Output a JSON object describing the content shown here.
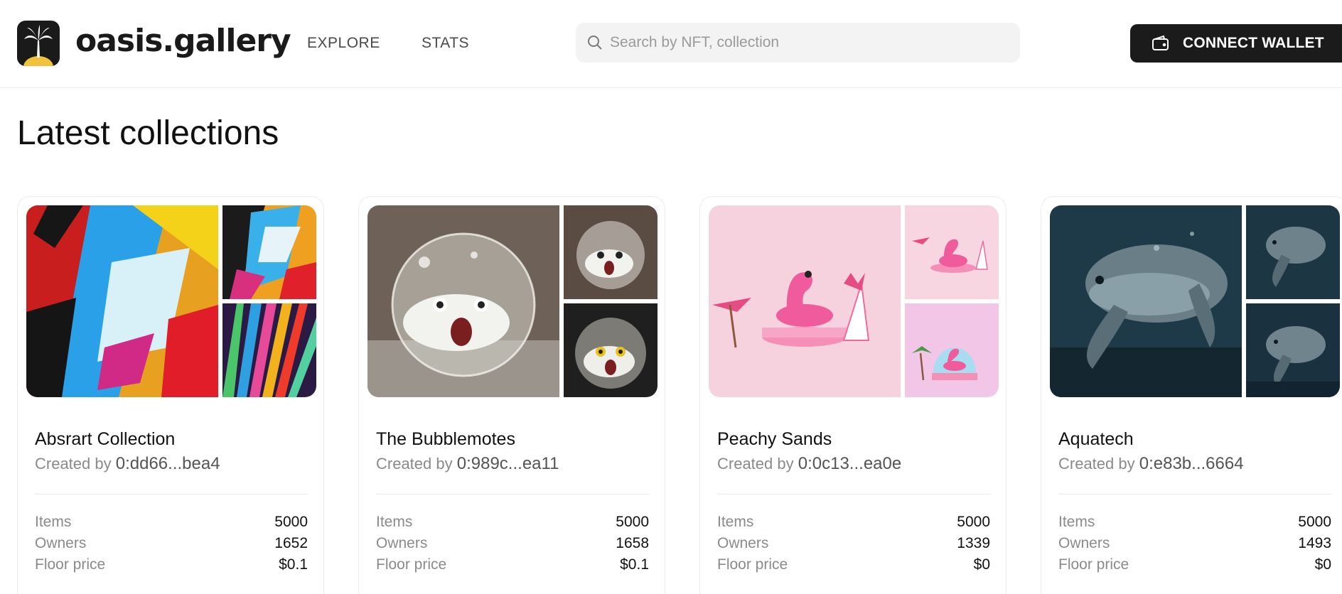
{
  "brand": {
    "name": "oasis.gallery",
    "logo_icon": "palm-tree-icon"
  },
  "nav": [
    {
      "label": "EXPLORE"
    },
    {
      "label": "STATS"
    }
  ],
  "search": {
    "placeholder": "Search by NFT, collection",
    "value": "",
    "icon": "search-icon"
  },
  "wallet_button": {
    "label": "CONNECT WALLET",
    "icon": "wallet-icon"
  },
  "page": {
    "title": "Latest collections"
  },
  "labels": {
    "created_by": "Created by",
    "items": "Items",
    "owners": "Owners",
    "floor_price": "Floor price"
  },
  "collections": [
    {
      "name": "Absrart Collection",
      "creator": "0:dd66...bea4",
      "items": "5000",
      "owners": "1652",
      "floor_price": "$0.1"
    },
    {
      "name": "The Bubblemotes",
      "creator": "0:989c...ea11",
      "items": "5000",
      "owners": "1658",
      "floor_price": "$0.1"
    },
    {
      "name": "Peachy Sands",
      "creator": "0:0c13...ea0e",
      "items": "5000",
      "owners": "1339",
      "floor_price": "$0"
    },
    {
      "name": "Aquatech",
      "creator": "0:e83b...6664",
      "items": "5000",
      "owners": "1493",
      "floor_price": "$0"
    }
  ],
  "colors": {
    "button_bg": "#1b1b1b",
    "search_bg": "#f3f3f3",
    "muted_text": "#8a8a8a",
    "logo_sun": "#f2c23c"
  }
}
